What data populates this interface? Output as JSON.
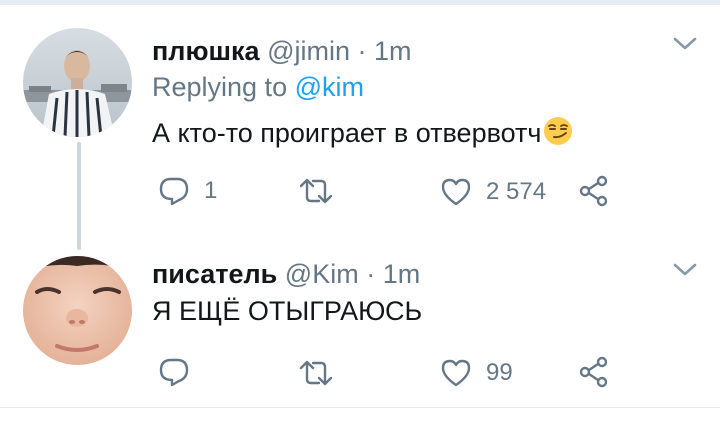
{
  "tweets": [
    {
      "name": "плюшка",
      "handle": "@jimin",
      "separator": "·",
      "time": "1m",
      "replying_prefix": "Replying to",
      "replying_handle": "@kim",
      "text": "А кто-то проиграет в отвервотч",
      "emoji": "smirking-face",
      "replies": "1",
      "retweets": "",
      "likes": "2 574"
    },
    {
      "name": "писатель",
      "handle": "@Kim",
      "separator": "·",
      "time": "1m",
      "text": "Я ЕЩЁ ОТЫГРАЮСЬ",
      "replies": "",
      "retweets": "",
      "likes": "99"
    }
  ],
  "colors": {
    "accent": "#1da1f2",
    "muted": "#657786",
    "text": "#14171a",
    "divider": "#e6ecf0",
    "thread_line": "#ccd6dd"
  }
}
